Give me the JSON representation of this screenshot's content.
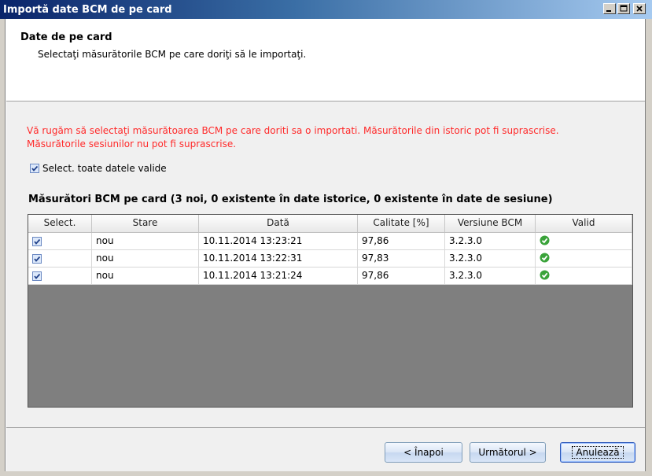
{
  "window": {
    "title": "Importă date BCM de pe card",
    "controls": [
      "minimize-icon",
      "maximize-icon",
      "close-icon"
    ]
  },
  "header": {
    "title": "Date de pe card",
    "subtitle": "Selectaţi măsurătorile BCM pe care doriţi să le importaţi."
  },
  "warning": {
    "line1": "Vă rugăm să selectaţi măsurătoarea BCM pe care doriti sa o importati. Măsurătorile din istoric pot fi suprascrise.",
    "line2": "Măsurătorile sesiunilor nu pot fi suprascrise."
  },
  "select_all": {
    "label": "Select. toate datele valide",
    "checked": true
  },
  "table": {
    "title": "Măsurători BCM pe card (3 noi, 0 existente în date istorice, 0 existente în date de sesiune)",
    "columns": [
      "Select.",
      "Stare",
      "Dată",
      "Calitate [%]",
      "Versiune BCM",
      "Valid"
    ],
    "rows": [
      {
        "selected": true,
        "stare": "nou",
        "data": "10.11.2014 13:23:21",
        "calitate": "97,86",
        "versiune": "3.2.3.0",
        "valid": "check-circle-icon"
      },
      {
        "selected": true,
        "stare": "nou",
        "data": "10.11.2014 13:22:31",
        "calitate": "97,83",
        "versiune": "3.2.3.0",
        "valid": "check-circle-icon"
      },
      {
        "selected": true,
        "stare": "nou",
        "data": "10.11.2014 13:21:24",
        "calitate": "97,86",
        "versiune": "3.2.3.0",
        "valid": "check-circle-icon"
      }
    ]
  },
  "buttons": {
    "back": "< Înapoi",
    "next": "Următorul >",
    "cancel": "Anulează"
  },
  "colors": {
    "warning": "#ff2a2a",
    "valid": "#3aa33a",
    "titlebar": "#0a246a"
  }
}
